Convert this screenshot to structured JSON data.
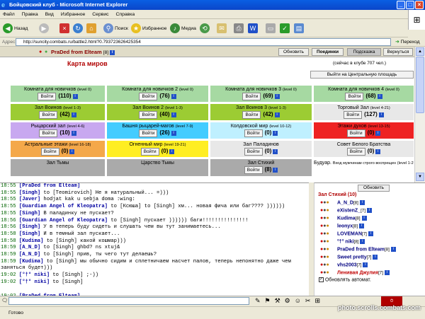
{
  "window": {
    "title": "Бойцовский клуб - Microsoft Internet Explorer"
  },
  "menu": [
    "Файл",
    "Правка",
    "Вид",
    "Избранное",
    "Сервис",
    "Справка"
  ],
  "toolbar": {
    "back": "Назад",
    "search": "Поиск",
    "favorites": "Избранное",
    "media": "Медиа"
  },
  "address": {
    "label": "Адрес:",
    "url": "http://suncity.combats.ru/battle2.html?0.793723626425354",
    "go": "Переход"
  },
  "header": {
    "user": "PraDed from Elteam",
    "level": "[8]",
    "buttons": [
      "Обновить",
      "Поединки",
      "Подсказка",
      "Вернуться"
    ]
  },
  "map": {
    "title": "Карта миров",
    "online": "(сейчас в клубе 707 чел.)",
    "center_button": "Выйти на Центральную площадь",
    "enter_label": "Войти"
  },
  "rooms": [
    {
      "name": "Комната для новичков",
      "lvl": "(level 0)",
      "count": "(110)",
      "color": "#a6d9a2"
    },
    {
      "name": "Комната для новичков 2",
      "lvl": "(level 0)",
      "count": "(76)",
      "color": "#a6d9a2"
    },
    {
      "name": "Комната для новичков 3",
      "lvl": "(level 0)",
      "count": "(69)",
      "color": "#a6d9a2"
    },
    {
      "name": "Комната для новичков 4",
      "lvl": "(level 0)",
      "count": "(68)",
      "color": "#a6d9a2"
    },
    {
      "name": "Зал Воинов",
      "lvl": "(level 1-3)",
      "count": "(42)",
      "color": "#9ccc33"
    },
    {
      "name": "Зал Воинов 2",
      "lvl": "(level 1-3)",
      "count": "(40)",
      "color": "#9ccc33"
    },
    {
      "name": "Зал Воинов 3",
      "lvl": "(level 1-3)",
      "count": "(42)",
      "color": "#9ccc33"
    },
    {
      "name": "Торговый Зал",
      "lvl": "(level 4-21)",
      "count": "(127)",
      "color": "#e8e8e8"
    },
    {
      "name": "Рыцарский зал",
      "lvl": "(level 4-6)",
      "count": "(10)",
      "color": "#c8a8f0"
    },
    {
      "name": "Башня рыцарей-магов",
      "lvl": "(level 7-9)",
      "count": "(26)",
      "color": "#44ccff"
    },
    {
      "name": "Колдовской мир",
      "lvl": "(level 10-12)",
      "count": "(0)",
      "color": "#bff0ff"
    },
    {
      "name": "Этажи духов",
      "lvl": "(level 13-15)",
      "count": "(0)",
      "color": "#ee2222"
    },
    {
      "name": "Астральные этажи",
      "lvl": "(level 16-18)",
      "count": "(0)",
      "color": "#f4a84a"
    },
    {
      "name": "Огненный мир",
      "lvl": "(level 19-21)",
      "count": "(0)",
      "color": "#ffee22"
    },
    {
      "name": "Зал Паладинов",
      "lvl": "",
      "count": "(0)",
      "color": "#e8e8e8"
    },
    {
      "name": "Совет Белого Братства",
      "lvl": "",
      "count": "(0)",
      "color": "#e8e8e8"
    },
    {
      "name": "Зал Тьмы",
      "lvl": "",
      "count": "",
      "color": "#aaaaaa"
    },
    {
      "name": "Царство Тьмы",
      "lvl": "",
      "count": "",
      "color": "#aaaaaa"
    },
    {
      "name": "Зал Стихий",
      "lvl": "",
      "count": "(8)",
      "color": "#aaaaaa"
    },
    {
      "name": "Будуар.",
      "lvl": "Вход мужчинам строго воспрещен (level 1-21)",
      "count": "",
      "color": "#ffffff"
    }
  ],
  "chat": [
    {
      "t": "18:55",
      "n": "[PraDed from Elteam]",
      "m": ""
    },
    {
      "t": "18:55",
      "n": "[Singh]",
      "m": " to [Teomirovich] Не я натуральный... =)))"
    },
    {
      "t": "18:55",
      "n": "[Javer]",
      "m": " hodjat kak u sebja doma :wing:"
    },
    {
      "t": "18:55",
      "n": "[Guardian Angel of Kleopatra]",
      "m": " to [Ксюша] to [Singh] хм... новая фича или баг???? ))))))"
    },
    {
      "t": "18:55",
      "n": "[Singh]",
      "m": " В паладинку не пускает?"
    },
    {
      "t": "18:56",
      "n": "[Guardian Angel of Kleopatra]",
      "m": " to [Singh] пускает )))))) баги!!!!!!!!!!!!!!!"
    },
    {
      "t": "18:56",
      "n": "[Singh]",
      "m": " У в теперь буду сидеть и слушать чем вы тут занимаетесь..."
    },
    {
      "t": "18:58",
      "n": "[Singh]",
      "m": " И в темный зал пускает..."
    },
    {
      "t": "18:58",
      "n": "[Kudima]",
      "m": " to [Singh] какой кошмар)))"
    },
    {
      "t": "18:59",
      "n": "[A_N_D]",
      "m": " to [Singh] ghbd? ns xtuj&"
    },
    {
      "t": "18:59",
      "n": "[A_N_D]",
      "m": " to [Singh] прив, ты чего тут делаешь?"
    },
    {
      "t": "18:59",
      "n": "[Kudima]",
      "m": " to [Singh] мы обычно сидим и сплетничаем насчет палов, теперь непонятно даже чем"
    },
    {
      "t": "",
      "n": "",
      "m": "заняться будет)))"
    },
    {
      "t": "19:02",
      "n": "[°†° niki]",
      "m": " to [Singh] ;-))"
    },
    {
      "t": "",
      "n": "",
      "m": ""
    },
    {
      "t": "19:02",
      "n": "[°†° niki]",
      "m": " to [Singh]"
    },
    {
      "t": "19:02",
      "n": "[PraDed from Elteam]",
      "m": ""
    }
  ],
  "room_panel": {
    "refresh": "Обновить",
    "title": "Зал Стихий (10)",
    "auto": "Обновлять автомат.",
    "users": [
      {
        "n": "A_N_D",
        "l": "[8]",
        "red": false
      },
      {
        "n": "eXistenZ_",
        "l": "[7]",
        "red": false
      },
      {
        "n": "Kudima",
        "l": "[8]",
        "red": false
      },
      {
        "n": "leonyx",
        "l": "[8]",
        "red": false
      },
      {
        "n": "LOVEMAN",
        "l": "[7]",
        "red": false
      },
      {
        "n": "°†° niki",
        "l": "[8]",
        "red": false
      },
      {
        "n": "PraDed from Elteam",
        "l": "[8]",
        "red": false
      },
      {
        "n": "Sweet pretty",
        "l": "[7]",
        "red": false
      },
      {
        "n": "vhs2003",
        "l": "[7]",
        "red": false
      },
      {
        "n": "Ленивая Джулия",
        "l": "[7]",
        "red": true
      }
    ]
  },
  "status": {
    "text": "Готово",
    "watermark": "photo.scrolls.combats.com"
  }
}
